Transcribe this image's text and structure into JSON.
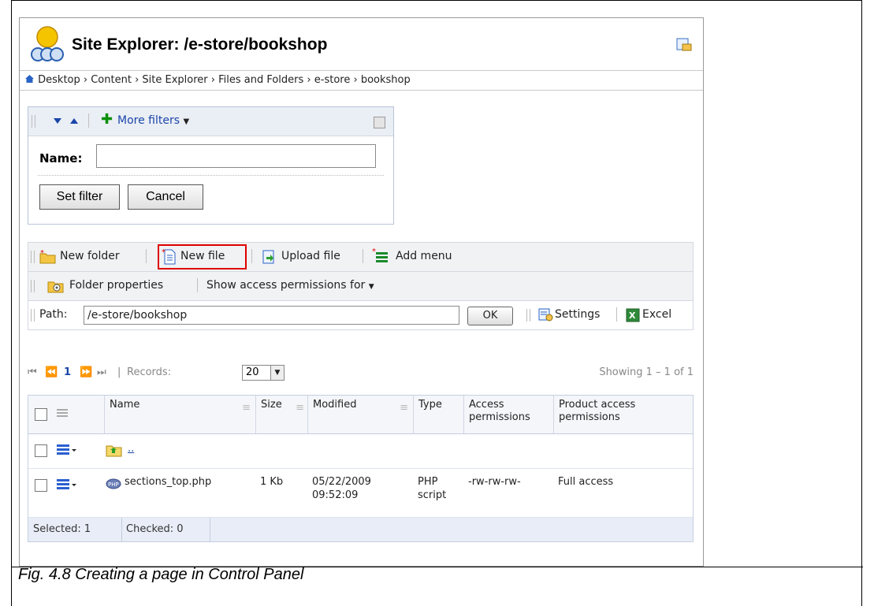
{
  "window": {
    "title": "Site Explorer: /e-store/bookshop"
  },
  "breadcrumb": [
    "Desktop",
    "Content",
    "Site Explorer",
    "Files and Folders",
    "e-store",
    "bookshop"
  ],
  "filter": {
    "more_filters": "More filters",
    "name_label": "Name:",
    "name_value": "",
    "set_filter": "Set filter",
    "cancel": "Cancel"
  },
  "toolbar": {
    "new_folder": "New folder",
    "new_file": "New file",
    "upload_file": "Upload file",
    "add_menu": "Add menu",
    "folder_properties": "Folder properties",
    "show_access": "Show access permissions for",
    "path_label": "Path:",
    "path_value": "/e-store/bookshop",
    "ok": "OK",
    "settings": "Settings",
    "excel": "Excel"
  },
  "pager": {
    "page": "1",
    "records_label": "Records:",
    "records_value": "20",
    "showing": "Showing 1 – 1 of 1"
  },
  "grid": {
    "columns": {
      "name": "Name",
      "size": "Size",
      "modified": "Modified",
      "type": "Type",
      "access": "Access permissions",
      "product_access": "Product access permissions"
    },
    "rows": [
      {
        "name": "..",
        "size": "",
        "modified": "",
        "type": "",
        "access": "",
        "product_access": ""
      },
      {
        "name": "sections_top.php",
        "size": "1 Kb",
        "modified_date": "05/22/2009",
        "modified_time": "09:52:09",
        "type_line1": "PHP",
        "type_line2": "script",
        "access": "-rw-rw-rw-",
        "product_access": "Full access"
      }
    ],
    "footer": {
      "selected": "Selected: 1",
      "checked": "Checked: 0"
    }
  },
  "caption": "Fig. 4.8 Creating a page in Control Panel",
  "colors": {
    "link": "#1a45a8",
    "highlight": "#e00000"
  }
}
